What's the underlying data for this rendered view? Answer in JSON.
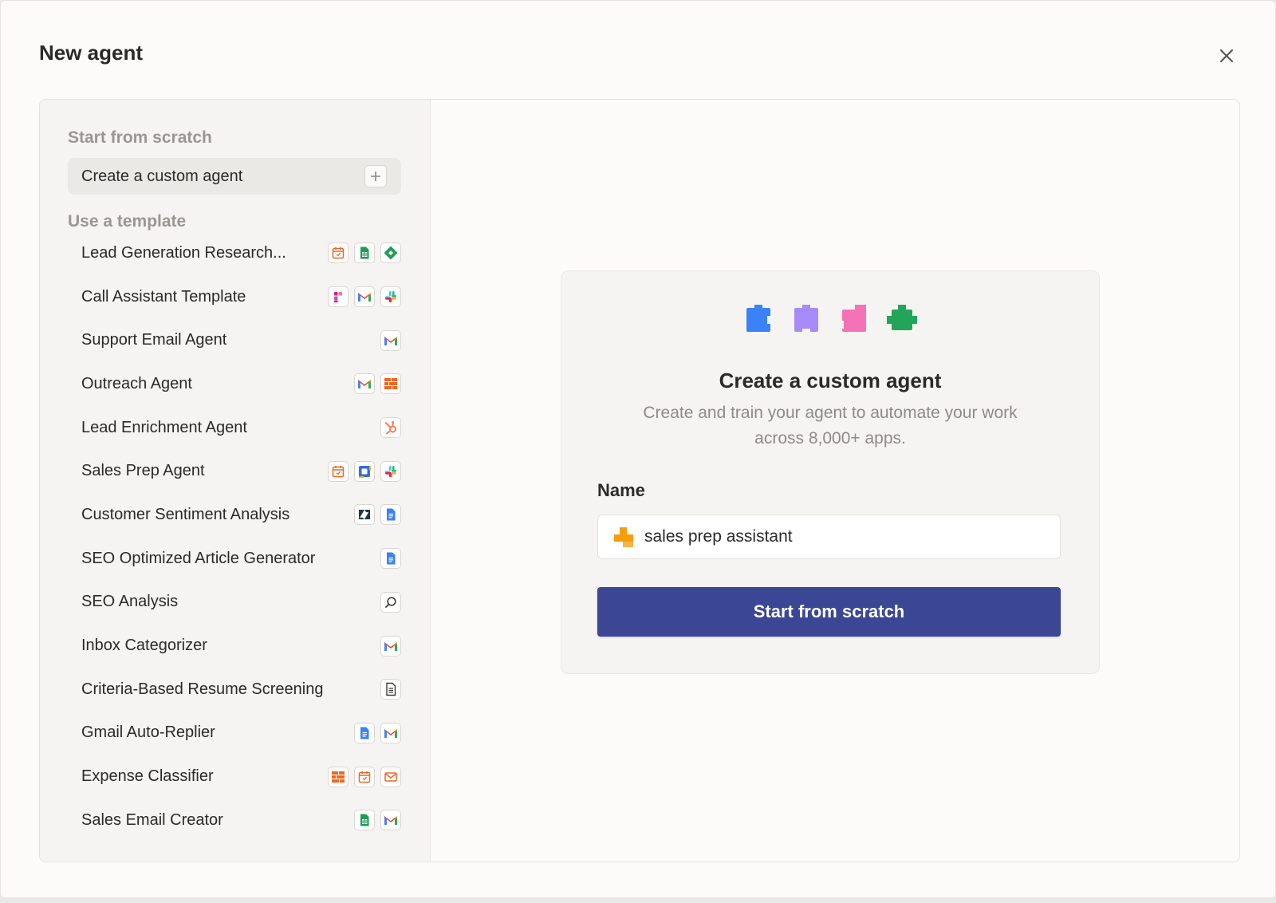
{
  "modal": {
    "title": "New agent"
  },
  "sidebar": {
    "scratch_section": "Start from scratch",
    "custom_agent_label": "Create a custom agent",
    "template_section": "Use a template",
    "templates": [
      {
        "label": "Lead Generation Research...",
        "icons": [
          "calendar-icon",
          "google-sheets-icon",
          "diamond-app-icon"
        ]
      },
      {
        "label": "Call Assistant Template",
        "icons": [
          "figma-app-icon",
          "gmail-icon",
          "slack-icon"
        ]
      },
      {
        "label": "Support Email Agent",
        "icons": [
          "gmail-icon"
        ]
      },
      {
        "label": "Outreach Agent",
        "icons": [
          "gmail-icon",
          "zapier-tables-icon"
        ]
      },
      {
        "label": "Lead Enrichment Agent",
        "icons": [
          "hubspot-icon"
        ]
      },
      {
        "label": "Sales Prep Agent",
        "icons": [
          "calendar-icon",
          "square-app-icon",
          "slack-icon"
        ]
      },
      {
        "label": "Customer Sentiment Analysis",
        "icons": [
          "zendesk-icon",
          "google-docs-icon"
        ]
      },
      {
        "label": "SEO Optimized Article Generator",
        "icons": [
          "google-docs-icon"
        ]
      },
      {
        "label": "SEO Analysis",
        "icons": [
          "search-icon"
        ]
      },
      {
        "label": "Inbox Categorizer",
        "icons": [
          "gmail-icon"
        ]
      },
      {
        "label": "Criteria-Based Resume Screening",
        "icons": [
          "document-icon"
        ]
      },
      {
        "label": "Gmail Auto-Replier",
        "icons": [
          "google-docs-icon",
          "gmail-icon"
        ]
      },
      {
        "label": "Expense Classifier",
        "icons": [
          "zapier-tables-icon",
          "calendar-icon",
          "email-icon"
        ]
      },
      {
        "label": "Sales Email Creator",
        "icons": [
          "google-sheets-icon",
          "gmail-icon"
        ]
      }
    ]
  },
  "card": {
    "title": "Create a custom agent",
    "description": "Create and train your agent to automate your work across 8,000+ apps.",
    "name_label": "Name",
    "name_value": "sales prep assistant",
    "button_label": "Start from scratch",
    "puzzle_colors": [
      "#3b82f6",
      "#a78bfa",
      "#f472b6",
      "#22a55a"
    ]
  },
  "colors": {
    "primary_button": "#3b4694"
  }
}
